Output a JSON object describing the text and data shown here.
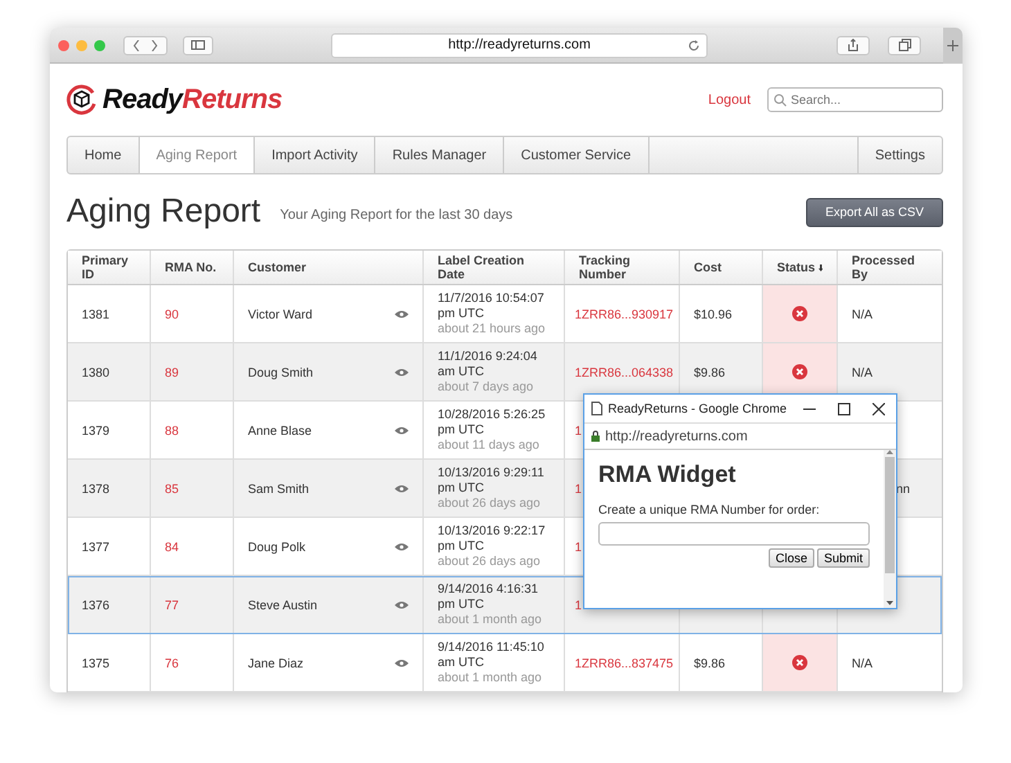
{
  "browser": {
    "url": "http://readyreturns.com"
  },
  "header": {
    "logo_first": "Ready",
    "logo_second": "Returns",
    "logout": "Logout",
    "search": {
      "placeholder": "Search..."
    }
  },
  "nav": [
    {
      "label": "Home",
      "selected": false
    },
    {
      "label": "Aging Report",
      "selected": true
    },
    {
      "label": "Import Activity",
      "selected": false
    },
    {
      "label": "Rules Manager",
      "selected": false
    },
    {
      "label": "Customer Service",
      "selected": false
    },
    {
      "label": "Settings",
      "selected": false
    }
  ],
  "page": {
    "title": "Aging Report",
    "subtitle": "Your Aging Report for the last 30 days",
    "export_button": "Export All as CSV"
  },
  "table": {
    "columns": [
      {
        "label": "Primary ID",
        "sorted": false
      },
      {
        "label": "RMA No.",
        "sorted": false
      },
      {
        "label": "Customer",
        "sorted": false
      },
      {
        "label": "Label Creation Date",
        "sorted": false
      },
      {
        "label": "Tracking Number",
        "sorted": false
      },
      {
        "label": "Cost",
        "sorted": false
      },
      {
        "label": "Status",
        "sorted": true
      },
      {
        "label": "Processed By",
        "sorted": false
      }
    ],
    "rows": [
      {
        "id": "1381",
        "rma": "90",
        "customer": "Victor Ward",
        "date": "11/7/2016 10:54:07 pm UTC",
        "ago": "about 21 hours ago",
        "tracking": "1ZRR86...930917",
        "cost": "$10.96",
        "failed": true,
        "processed_by": "N/A",
        "selected": false
      },
      {
        "id": "1380",
        "rma": "89",
        "customer": "Doug Smith",
        "date": "11/1/2016 9:24:04 am UTC",
        "ago": "about 7 days ago",
        "tracking": "1ZRR86...064338",
        "cost": "$9.86",
        "failed": true,
        "processed_by": "N/A",
        "selected": false
      },
      {
        "id": "1379",
        "rma": "88",
        "customer": "Anne Blase",
        "date": "10/28/2016 5:26:25 pm UTC",
        "ago": "about 11 days ago",
        "tracking": "1",
        "selected": false
      },
      {
        "id": "1378",
        "rma": "85",
        "customer": "Sam Smith",
        "date": "10/13/2016 9:29:11 pm UTC",
        "ago": "about 26 days ago",
        "tracking": "1",
        "processed_by": "nn",
        "selected": false
      },
      {
        "id": "1377",
        "rma": "84",
        "customer": "Doug Polk",
        "date": "10/13/2016 9:22:17 pm UTC",
        "ago": "about 26 days ago",
        "tracking": "1",
        "selected": false
      },
      {
        "id": "1376",
        "rma": "77",
        "customer": "Steve Austin",
        "date": "9/14/2016 4:16:31 pm UTC",
        "ago": "about 1 month ago",
        "tracking": "1",
        "selected": true
      },
      {
        "id": "1375",
        "rma": "76",
        "customer": "Jane Diaz",
        "date": "9/14/2016 11:45:10 am UTC",
        "ago": "about 1 month ago",
        "tracking": "1ZRR86...837475",
        "cost": "$9.86",
        "failed": true,
        "processed_by": "N/A",
        "selected": false
      }
    ]
  },
  "popup": {
    "window_title": "ReadyReturns - Google Chrome",
    "url": "http://readyreturns.com",
    "heading": "RMA Widget",
    "label": "Create a unique RMA Number for order:",
    "buttons": [
      "Close",
      "Submit"
    ]
  }
}
